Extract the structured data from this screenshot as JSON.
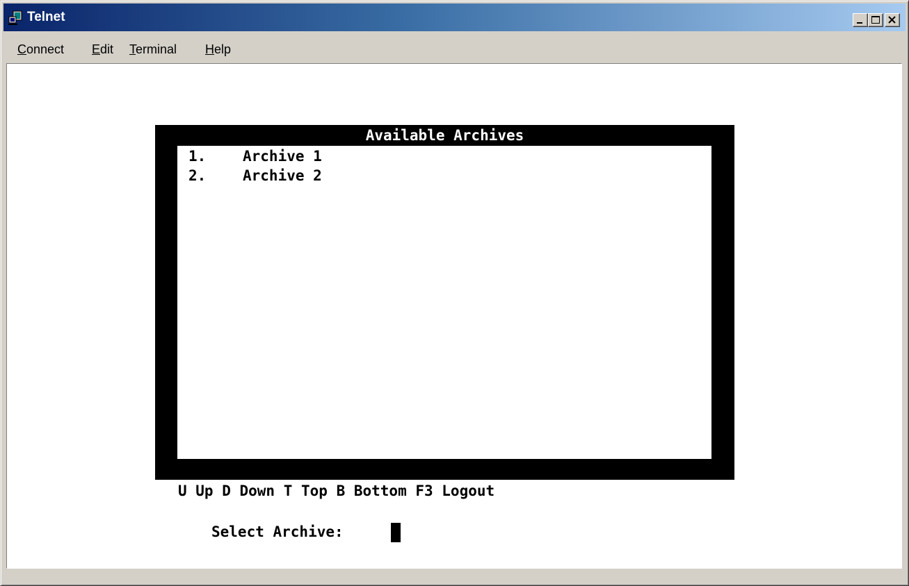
{
  "window": {
    "title": "Telnet",
    "icon": "telnet-app-icon"
  },
  "caption_buttons": {
    "minimize": "minimize-icon",
    "maximize": "maximize-icon",
    "close": "close-icon"
  },
  "menu": {
    "items": [
      {
        "accel": "C",
        "rest": "onnect"
      },
      {
        "accel": "E",
        "rest": "dit"
      },
      {
        "accel": "T",
        "rest": "erminal"
      },
      {
        "accel": "H",
        "rest": "elp"
      }
    ]
  },
  "terminal": {
    "panel_title": "Available Archives",
    "archives": [
      {
        "num": "1.",
        "name": "Archive 1"
      },
      {
        "num": "2.",
        "name": "Archive 2"
      }
    ],
    "keys_line": "U Up D Down T Top B Bottom F3 Logout",
    "prompt": "Select Archive: "
  },
  "colors": {
    "titlebar_start": "#0a246a",
    "titlebar_end": "#a6caf0",
    "terminal_frame": "#000000",
    "terminal_background": "#ffffff"
  }
}
